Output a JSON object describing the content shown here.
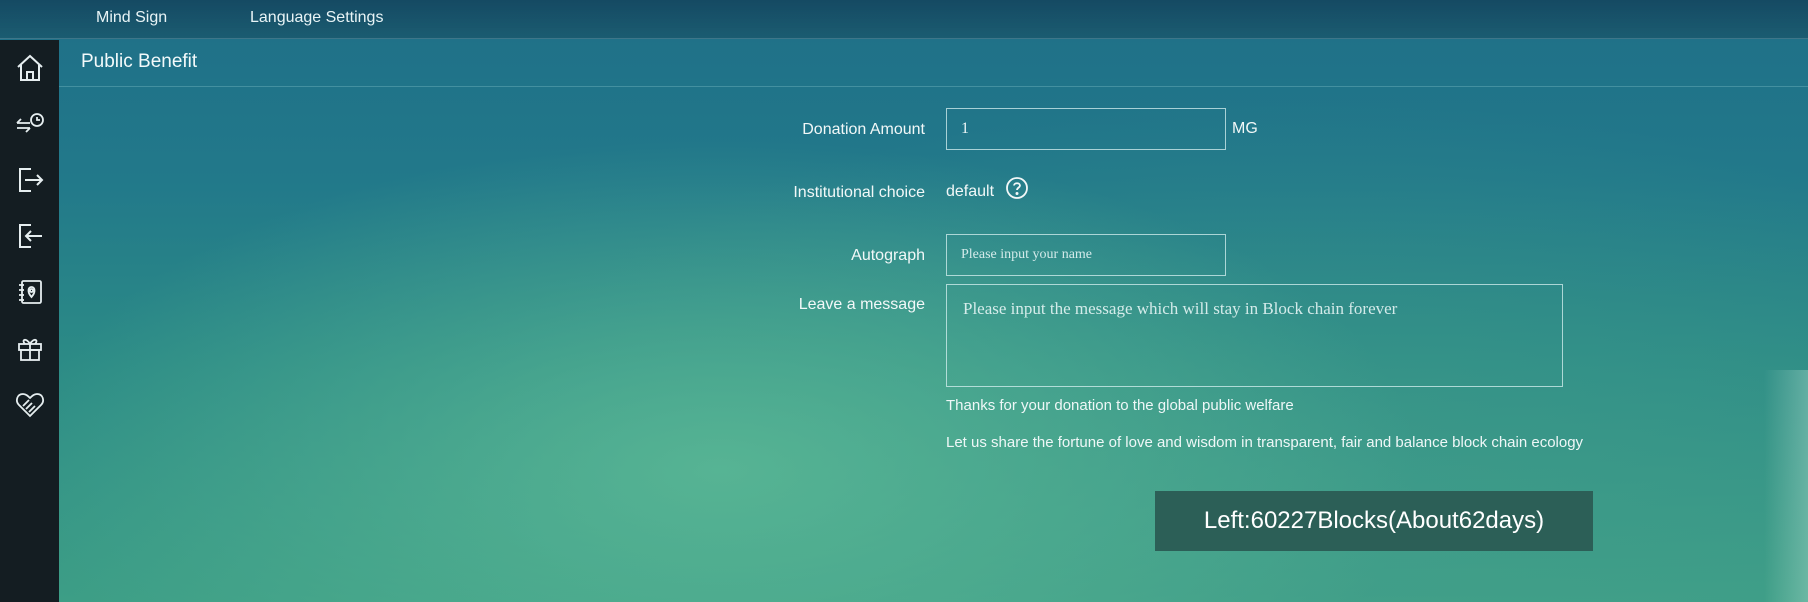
{
  "topbar": {
    "menu": [
      "Mind Sign",
      "Language Settings"
    ]
  },
  "sidebar": {
    "icons": [
      "home-icon",
      "transfer-history-icon",
      "export-icon",
      "import-icon",
      "address-book-icon",
      "gift-icon",
      "heart-hand-icon"
    ]
  },
  "page": {
    "title": "Public Benefit"
  },
  "form": {
    "donation_label": "Donation Amount",
    "donation_value": "1",
    "unit": "MG",
    "institution_label": "Institutional choice",
    "institution_value": "default",
    "autograph_label": "Autograph",
    "autograph_placeholder": "Please input your name",
    "message_label": "Leave a message",
    "message_placeholder": "Please input the message which will stay in Block chain forever"
  },
  "notes": {
    "thanks": "Thanks for your donation to the global public welfare",
    "share": "Let us share the fortune of love and wisdom in transparent, fair and balance block chain ecology"
  },
  "status": {
    "left_blocks": "Left:60227Blocks(About62days)"
  },
  "colors": {
    "sidebar_bg": "#141d22",
    "timer_bg": "#2c5f57"
  }
}
